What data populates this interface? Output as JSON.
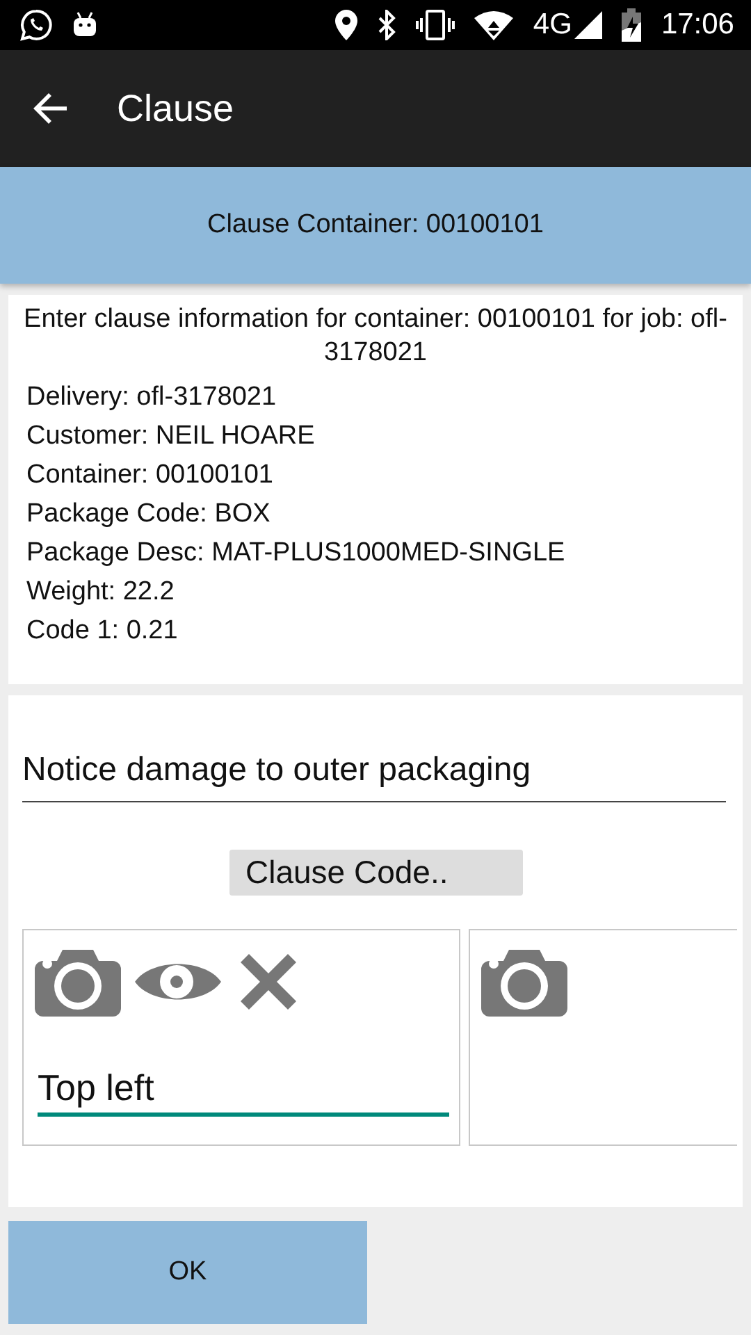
{
  "status_bar": {
    "network": "4G",
    "time": "17:06"
  },
  "app_bar": {
    "title": "Clause"
  },
  "header": {
    "title": "Clause Container: 00100101"
  },
  "info": {
    "intro": "Enter clause information for container: 00100101 for job: ofl-3178021",
    "lines": [
      "Delivery: ofl-3178021",
      "Customer: NEIL HOARE",
      "Container: 00100101",
      "Package Code: BOX",
      "Package Desc: MAT-PLUS1000MED-SINGLE",
      "Weight: 22.2",
      "Code 1: 0.21"
    ]
  },
  "clause": {
    "description": "Notice damage to outer packaging",
    "code_button": "Clause Code.."
  },
  "photo_slots": [
    {
      "kind": "taken",
      "caption": "Top left",
      "focused": true
    },
    {
      "kind": "empty"
    }
  ],
  "ok_button": "OK"
}
